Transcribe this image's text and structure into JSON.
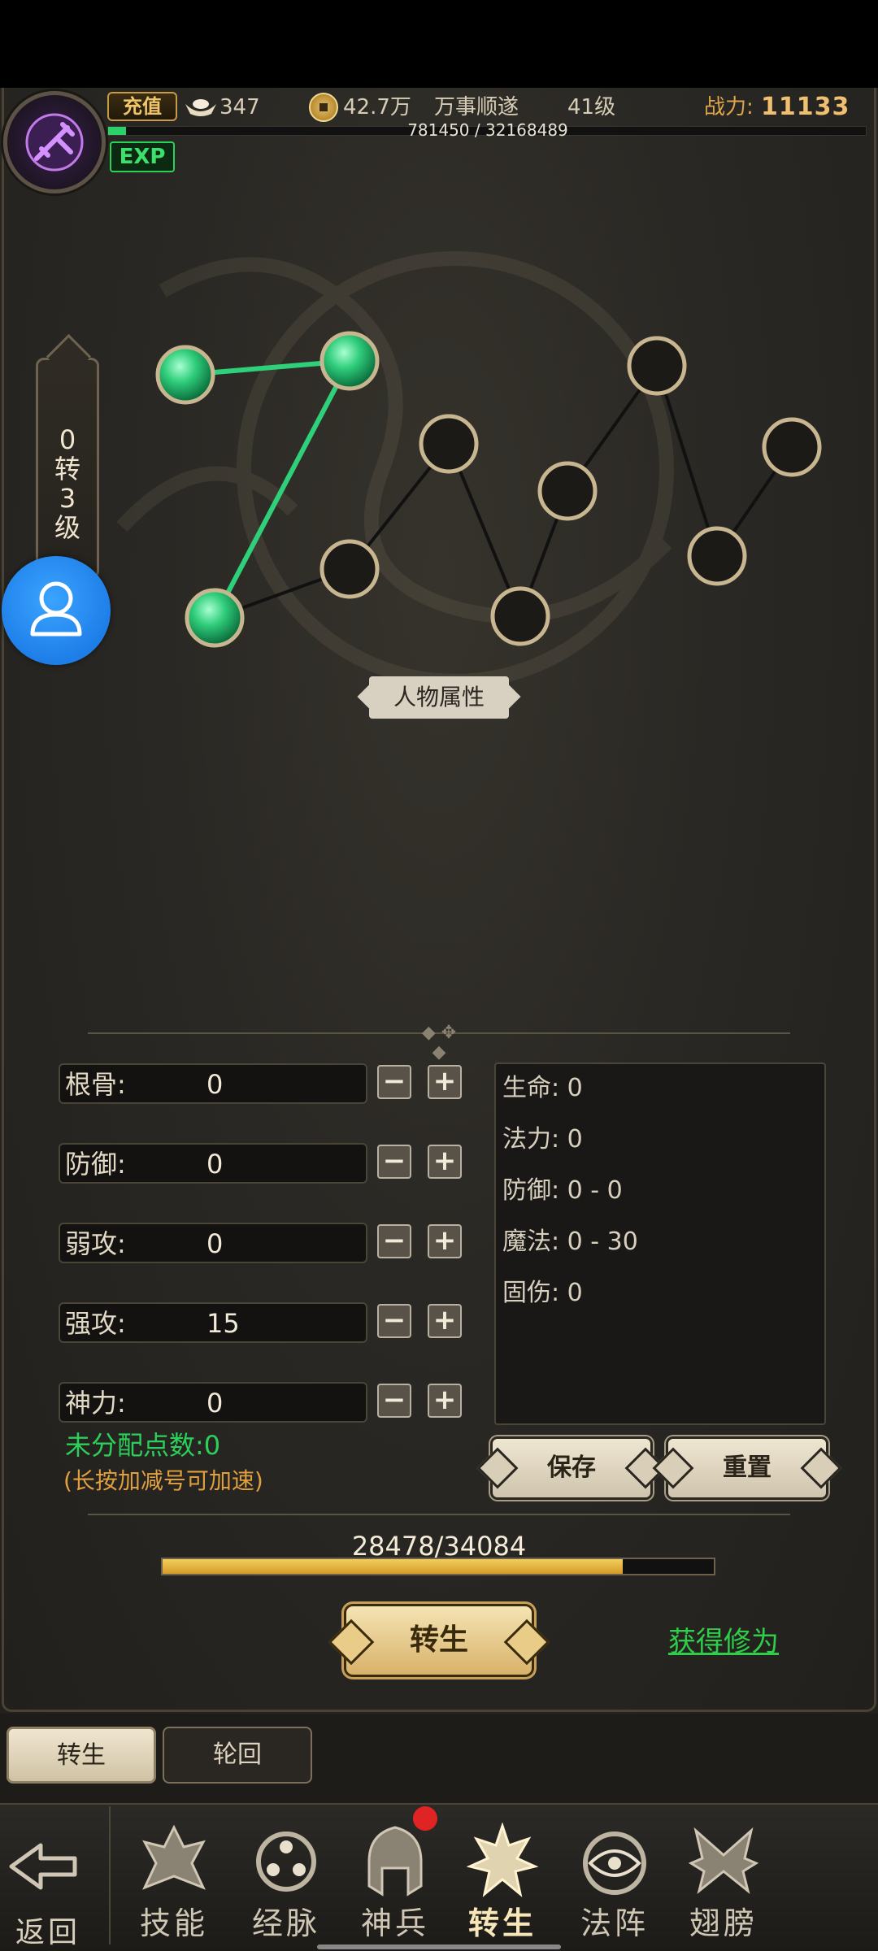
{
  "header": {
    "recharge_label": "充值",
    "ingot_count": "347",
    "coin_amount": "42.7万",
    "player_title": "万事顺遂",
    "level": "41级",
    "power_label": "战力:",
    "power_value": "11133",
    "exp_text": "781450 / 32168489",
    "exp_badge": "EXP",
    "exp_fraction": 0.024
  },
  "rank": {
    "lines": [
      "0",
      "转",
      "3",
      "级"
    ]
  },
  "graph": {
    "active_nodes": 3,
    "total_nodes": 11
  },
  "section_title": "人物属性",
  "attributes": [
    {
      "label": "根骨:",
      "value": "0"
    },
    {
      "label": "防御:",
      "value": "0"
    },
    {
      "label": "弱攻:",
      "value": "0"
    },
    {
      "label": "强攻:",
      "value": "15"
    },
    {
      "label": "神力:",
      "value": "0"
    }
  ],
  "buttons": {
    "minus": "−",
    "plus": "+",
    "save": "保存",
    "reset": "重置",
    "reincarnate": "转生",
    "gain_cultivation": "获得修为"
  },
  "stats": [
    "生命: 0",
    "法力: 0",
    "防御: 0 - 0",
    "魔法: 0 - 30",
    "固伤: 0"
  ],
  "points": {
    "unassigned": "未分配点数:0",
    "hint": "(长按加减号可加速)"
  },
  "progress": {
    "text": "28478/34084",
    "fraction": 0.8355
  },
  "subtabs": [
    "转生",
    "轮回"
  ],
  "nav": {
    "back_label": "返回",
    "items": [
      {
        "label": "技能",
        "icon": "skill-icon"
      },
      {
        "label": "经脉",
        "icon": "meridian-icon"
      },
      {
        "label": "神兵",
        "icon": "divine-weapon-icon"
      },
      {
        "label": "转生",
        "icon": "reincarnation-icon"
      },
      {
        "label": "法阵",
        "icon": "formation-icon"
      },
      {
        "label": "翅膀",
        "icon": "wings-icon"
      }
    ]
  },
  "colors": {
    "active_node": "#2fd07a",
    "link_active": "#2fd07a",
    "accent_gold": "#f0c070",
    "green_text": "#2ad05a"
  }
}
